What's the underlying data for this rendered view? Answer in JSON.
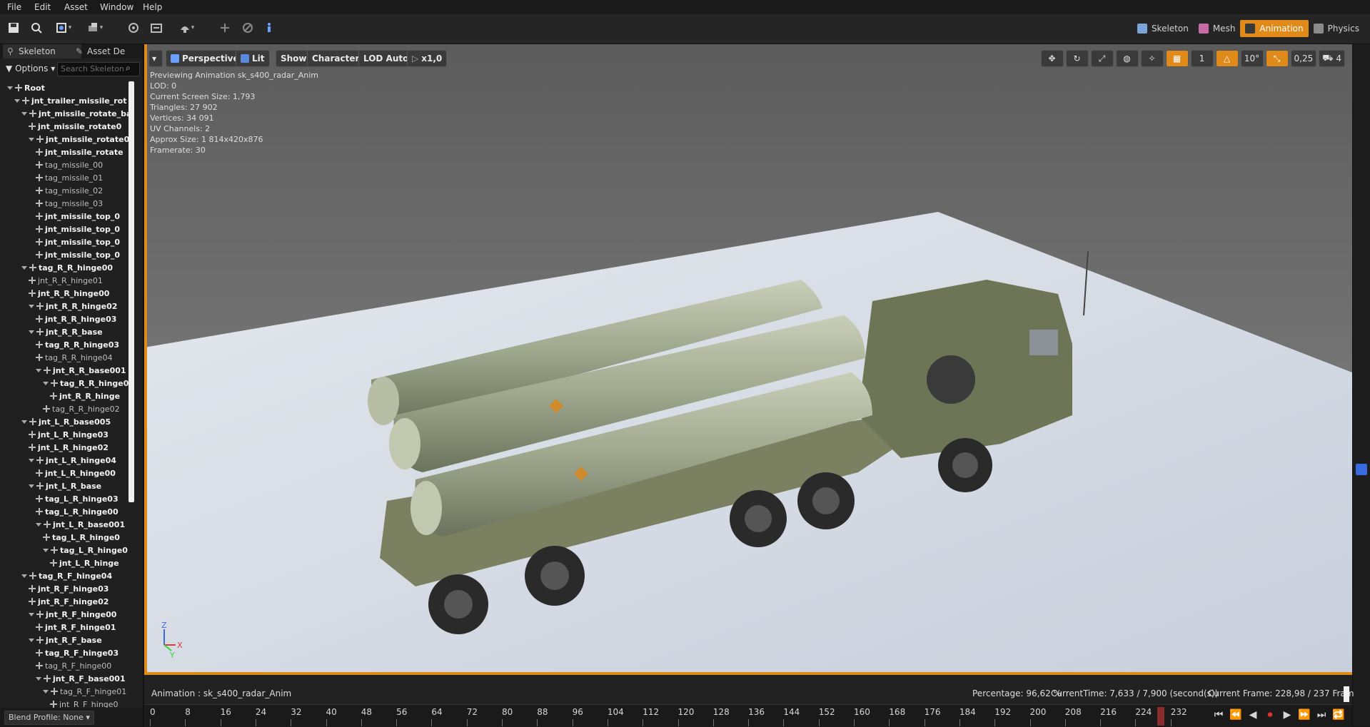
{
  "menu": [
    "File",
    "Edit",
    "Asset",
    "Window",
    "Help"
  ],
  "modes": [
    {
      "label": "Skeleton",
      "icon": "skeleton-icon"
    },
    {
      "label": "Mesh",
      "icon": "mesh-icon"
    },
    {
      "label": "Animation",
      "icon": "animation-icon"
    },
    {
      "label": "Physics",
      "icon": "physics-icon"
    }
  ],
  "left_panel": {
    "tabs": [
      "Skeleton",
      "Asset De"
    ],
    "options_label": "Options",
    "search_placeholder": "Search Skeleton",
    "tree": [
      {
        "label": "Root",
        "indent": 0,
        "bold": true,
        "toggle": true
      },
      {
        "label": "jnt_trailer_missile_rot",
        "indent": 1,
        "bold": true,
        "toggle": true
      },
      {
        "label": "jnt_missile_rotate_ba",
        "indent": 2,
        "bold": true,
        "toggle": true
      },
      {
        "label": "jnt_missile_rotate0",
        "indent": 3,
        "bold": true,
        "toggle": false
      },
      {
        "label": "jnt_missile_rotate0",
        "indent": 3,
        "bold": true,
        "toggle": true
      },
      {
        "label": "jnt_missile_rotate",
        "indent": 4,
        "bold": true,
        "toggle": false
      },
      {
        "label": "tag_missile_00",
        "indent": 4,
        "bold": false,
        "toggle": false
      },
      {
        "label": "tag_missile_01",
        "indent": 4,
        "bold": false,
        "toggle": false
      },
      {
        "label": "tag_missile_02",
        "indent": 4,
        "bold": false,
        "toggle": false
      },
      {
        "label": "tag_missile_03",
        "indent": 4,
        "bold": false,
        "toggle": false
      },
      {
        "label": "jnt_missile_top_0",
        "indent": 4,
        "bold": true,
        "toggle": false
      },
      {
        "label": "jnt_missile_top_0",
        "indent": 4,
        "bold": true,
        "toggle": false
      },
      {
        "label": "jnt_missile_top_0",
        "indent": 4,
        "bold": true,
        "toggle": false
      },
      {
        "label": "jnt_missile_top_0",
        "indent": 4,
        "bold": true,
        "toggle": false
      },
      {
        "label": "tag_R_R_hinge00",
        "indent": 2,
        "bold": true,
        "toggle": true
      },
      {
        "label": "jnt_R_R_hinge01",
        "indent": 3,
        "bold": false,
        "toggle": false
      },
      {
        "label": "jnt_R_R_hinge00",
        "indent": 3,
        "bold": true,
        "toggle": false
      },
      {
        "label": "jnt_R_R_hinge02",
        "indent": 3,
        "bold": true,
        "toggle": true
      },
      {
        "label": "jnt_R_R_hinge03",
        "indent": 4,
        "bold": true,
        "toggle": false
      },
      {
        "label": "jnt_R_R_base",
        "indent": 3,
        "bold": true,
        "toggle": true
      },
      {
        "label": "tag_R_R_hinge03",
        "indent": 4,
        "bold": true,
        "toggle": false
      },
      {
        "label": "tag_R_R_hinge04",
        "indent": 4,
        "bold": false,
        "toggle": false
      },
      {
        "label": "jnt_R_R_base001",
        "indent": 4,
        "bold": true,
        "toggle": true
      },
      {
        "label": "tag_R_R_hinge0",
        "indent": 5,
        "bold": true,
        "toggle": true
      },
      {
        "label": "jnt_R_R_hinge",
        "indent": 6,
        "bold": true,
        "toggle": false
      },
      {
        "label": "tag_R_R_hinge02",
        "indent": 5,
        "bold": false,
        "toggle": false
      },
      {
        "label": "jnt_L_R_base005",
        "indent": 2,
        "bold": true,
        "toggle": true
      },
      {
        "label": "jnt_L_R_hinge03",
        "indent": 3,
        "bold": true,
        "toggle": false
      },
      {
        "label": "jnt_L_R_hinge02",
        "indent": 3,
        "bold": true,
        "toggle": false
      },
      {
        "label": "jnt_L_R_hinge04",
        "indent": 3,
        "bold": true,
        "toggle": true
      },
      {
        "label": "jnt_L_R_hinge00",
        "indent": 4,
        "bold": true,
        "toggle": false
      },
      {
        "label": "jnt_L_R_base",
        "indent": 3,
        "bold": true,
        "toggle": true
      },
      {
        "label": "tag_L_R_hinge03",
        "indent": 4,
        "bold": true,
        "toggle": false
      },
      {
        "label": "tag_L_R_hinge00",
        "indent": 4,
        "bold": true,
        "toggle": false
      },
      {
        "label": "jnt_L_R_base001",
        "indent": 4,
        "bold": true,
        "toggle": true
      },
      {
        "label": "tag_L_R_hinge0",
        "indent": 5,
        "bold": true,
        "toggle": false
      },
      {
        "label": "tag_L_R_hinge0",
        "indent": 5,
        "bold": true,
        "toggle": true
      },
      {
        "label": "jnt_L_R_hinge",
        "indent": 6,
        "bold": true,
        "toggle": false
      },
      {
        "label": "tag_R_F_hinge04",
        "indent": 2,
        "bold": true,
        "toggle": true
      },
      {
        "label": "jnt_R_F_hinge03",
        "indent": 3,
        "bold": true,
        "toggle": false
      },
      {
        "label": "jnt_R_F_hinge02",
        "indent": 3,
        "bold": true,
        "toggle": false
      },
      {
        "label": "jnt_R_F_hinge00",
        "indent": 3,
        "bold": true,
        "toggle": true
      },
      {
        "label": "jnt_R_F_hinge01",
        "indent": 4,
        "bold": true,
        "toggle": false
      },
      {
        "label": "jnt_R_F_base",
        "indent": 3,
        "bold": true,
        "toggle": true
      },
      {
        "label": "tag_R_F_hinge03",
        "indent": 4,
        "bold": true,
        "toggle": false
      },
      {
        "label": "tag_R_F_hinge00",
        "indent": 4,
        "bold": false,
        "toggle": false
      },
      {
        "label": "jnt_R_F_base001",
        "indent": 4,
        "bold": true,
        "toggle": true
      },
      {
        "label": "tag_R_F_hinge01",
        "indent": 5,
        "bold": false,
        "toggle": true
      },
      {
        "label": "jnt_R_F_hinge0",
        "indent": 6,
        "bold": false,
        "toggle": false
      }
    ],
    "blend_profile": "Blend Profile: None"
  },
  "viewport": {
    "buttons": [
      "Perspective",
      "Lit",
      "Show",
      "Character",
      "LOD Auto",
      "x1,0"
    ],
    "stats": [
      "Previewing Animation sk_s400_radar_Anim",
      "LOD: 0",
      "Current Screen Size: 1,793",
      "Triangles: 27 902",
      "Vertices: 34 091",
      "UV Channels: 2",
      "Approx Size: 1 814x420x876",
      "Framerate: 30"
    ],
    "right_tools": [
      "1",
      "10°",
      "0,25",
      "4"
    ],
    "axis_labels": {
      "z": "Z",
      "x": "X",
      "y": "Y"
    }
  },
  "timeline": {
    "animation_label": "Animation :  sk_s400_radar_Anim",
    "percentage": "Percentage:  96,62 %",
    "current_time": "CurrentTime:  7,633 / 7,900 (second(s))",
    "current_frame": "Current Frame:  228,98 / 237 Fram",
    "ticks": [
      "0",
      "8",
      "16",
      "24",
      "32",
      "40",
      "48",
      "56",
      "64",
      "72",
      "80",
      "88",
      "96",
      "104",
      "112",
      "120",
      "128",
      "136",
      "144",
      "152",
      "160",
      "168",
      "176",
      "184",
      "192",
      "200",
      "208",
      "216",
      "224",
      "232"
    ],
    "playhead_frame": 228.98,
    "total_frames": 237
  },
  "colors": {
    "accent": "#e08a1a",
    "panel": "#202020",
    "viewport_bg_top": "#6f6f6f",
    "floor": "#cdd3dd"
  }
}
